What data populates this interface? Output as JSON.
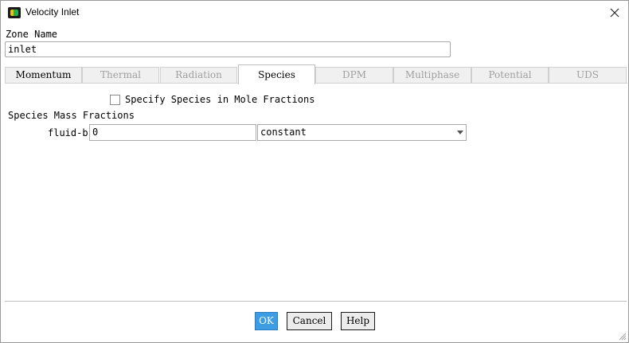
{
  "window": {
    "title": "Velocity Inlet"
  },
  "zone": {
    "label": "Zone Name",
    "value": "inlet"
  },
  "tabs": [
    {
      "label": "Momentum",
      "state": "enabled"
    },
    {
      "label": "Thermal",
      "state": "disabled"
    },
    {
      "label": "Radiation",
      "state": "disabled"
    },
    {
      "label": "Species",
      "state": "active"
    },
    {
      "label": "DPM",
      "state": "disabled"
    },
    {
      "label": "Multiphase",
      "state": "disabled"
    },
    {
      "label": "Potential",
      "state": "disabled"
    },
    {
      "label": "UDS",
      "state": "disabled"
    }
  ],
  "species": {
    "mole_fraction_checkbox_label": "Specify Species in Mole Fractions",
    "mole_fraction_checked": false,
    "section_title": "Species Mass Fractions",
    "fluid_label": "fluid-b",
    "fluid_value": "0",
    "method_value": "constant"
  },
  "buttons": {
    "ok": "OK",
    "cancel": "Cancel",
    "help": "Help"
  },
  "colors": {
    "ok_button": "#3c9ce4",
    "app_icon_yellow": "#f2c200",
    "app_icon_green": "#22b14c"
  },
  "icons": {
    "app": "app-icon",
    "close": "close-icon",
    "dropdown": "chevron-down-icon",
    "resize": "resize-grip-icon"
  }
}
